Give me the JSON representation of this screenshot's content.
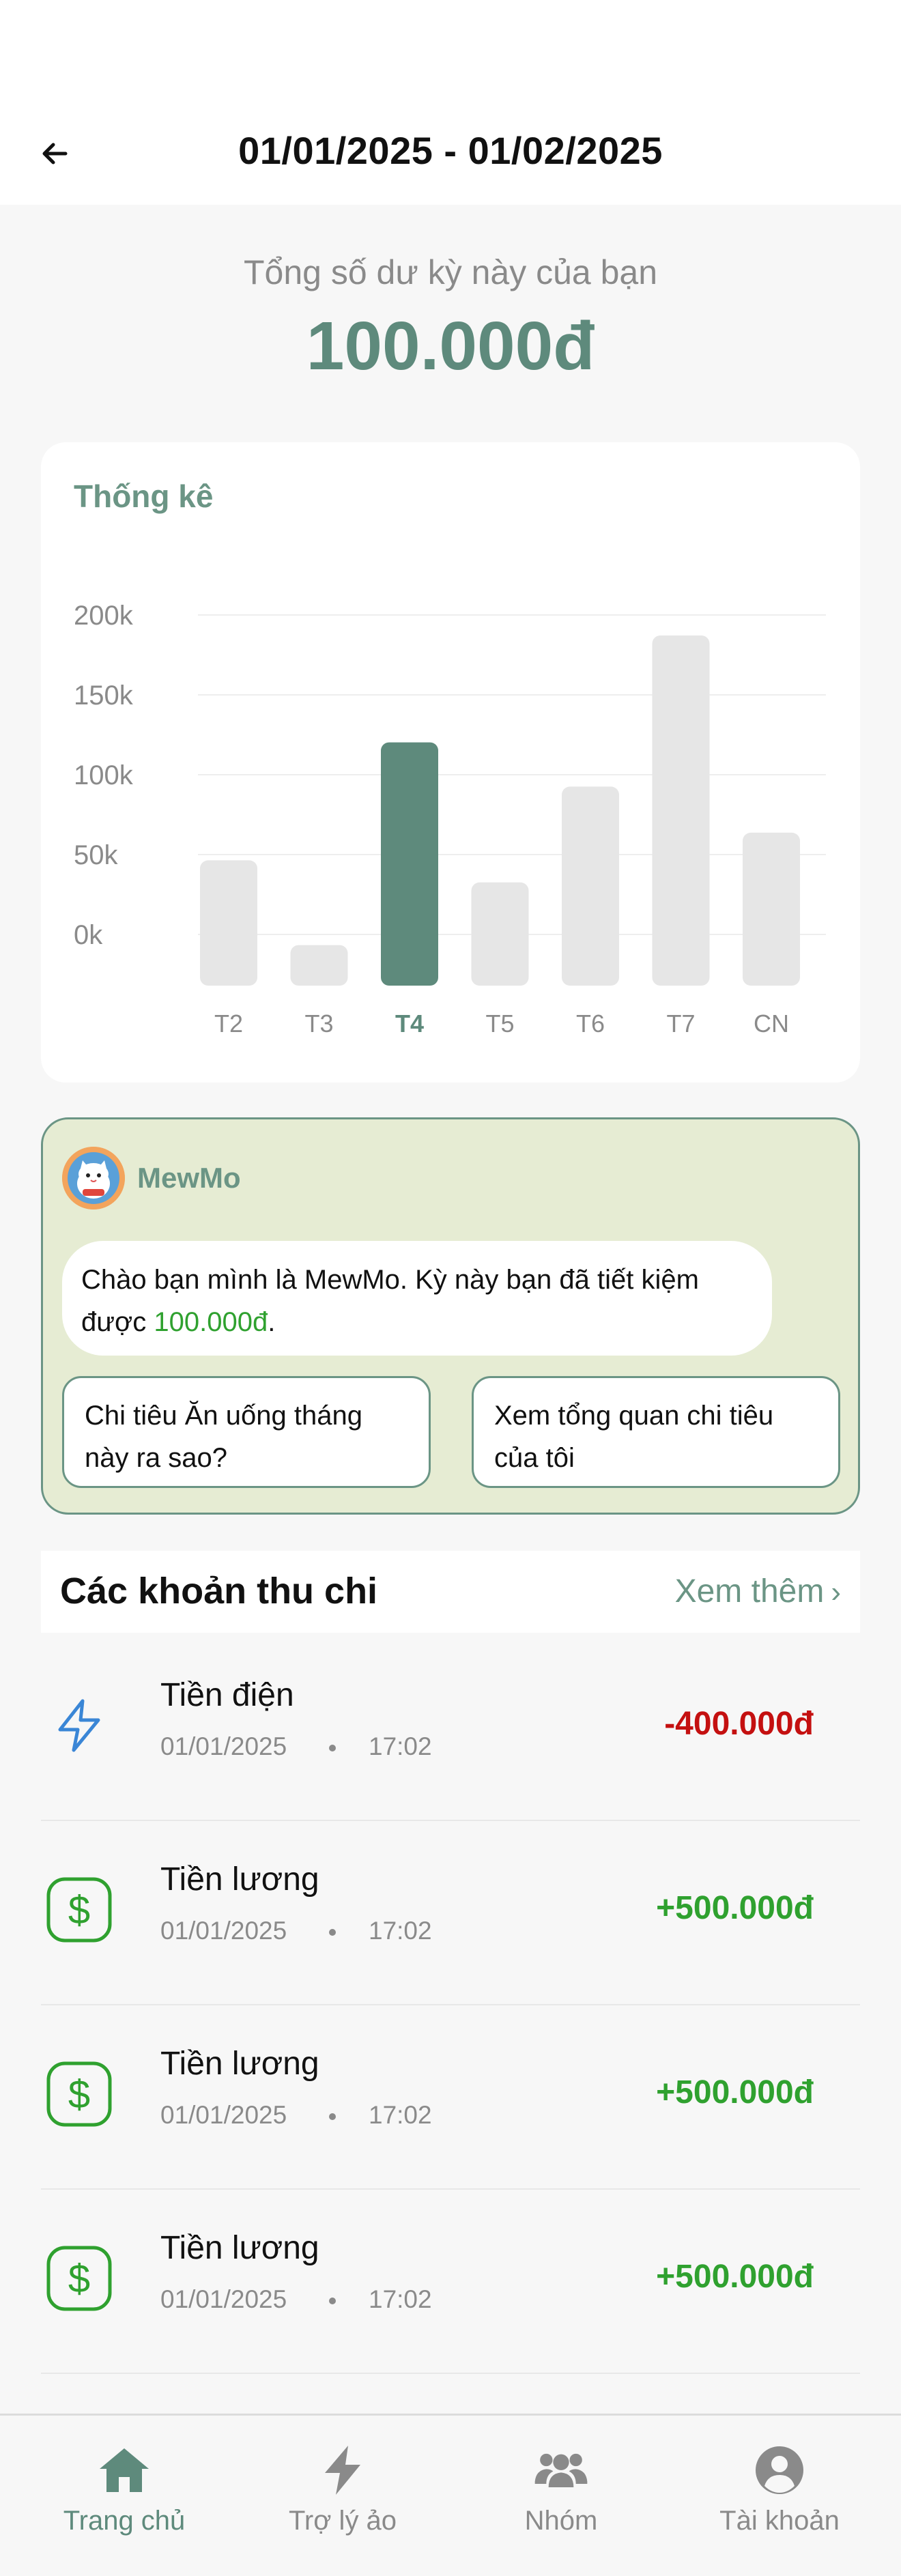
{
  "header": {
    "title": "01/01/2025 - 01/02/2025",
    "back_icon": "arrow-left-icon"
  },
  "balance": {
    "label": "Tổng số dư kỳ này của bạn",
    "value": "100.000đ"
  },
  "stats": {
    "title": "Thống kê"
  },
  "chart_data": {
    "type": "bar",
    "categories": [
      "T2",
      "T3",
      "T4",
      "T5",
      "T6",
      "T7",
      "CN"
    ],
    "values": [
      68,
      22,
      132,
      56,
      108,
      190,
      83
    ],
    "highlighted_category": "T4",
    "ytick_labels": [
      "200k",
      "150k",
      "100k",
      "50k",
      "0k"
    ],
    "colors": {
      "bar": "#e6e6e6",
      "highlight": "#5e8a7c",
      "grid": "#eeeeee"
    }
  },
  "assistant": {
    "name": "MewMo",
    "message_prefix": "Chào bạn mình là MewMo. Kỳ này bạn đã tiết kiệm được ",
    "message_amount": "100.000đ",
    "message_suffix": ".",
    "suggestions": [
      "Chi tiêu Ăn uống tháng này ra sao?",
      "Xem tổng quan chi tiêu của tôi"
    ]
  },
  "transactions_section": {
    "title": "Các khoản thu chi",
    "see_more": "Xem thêm",
    "see_more_icon": "chevron-right-icon"
  },
  "transactions": [
    {
      "name": "Tiền điện",
      "date": "01/01/2025",
      "time": "17:02",
      "amount": "-400.000đ",
      "type": "expense",
      "icon": "lightning-icon"
    },
    {
      "name": "Tiền lương",
      "date": "01/01/2025",
      "time": "17:02",
      "amount": "+500.000đ",
      "type": "income",
      "icon": "dollar-icon"
    },
    {
      "name": "Tiền lương",
      "date": "01/01/2025",
      "time": "17:02",
      "amount": "+500.000đ",
      "type": "income",
      "icon": "dollar-icon"
    },
    {
      "name": "Tiền lương",
      "date": "01/01/2025",
      "time": "17:02",
      "amount": "+500.000đ",
      "type": "income",
      "icon": "dollar-icon"
    }
  ],
  "nav": [
    {
      "label": "Trang chủ",
      "icon": "home-icon",
      "active": true
    },
    {
      "label": "Trợ lý ảo",
      "icon": "lightning-icon",
      "active": false
    },
    {
      "label": "Nhóm",
      "icon": "group-icon",
      "active": false
    },
    {
      "label": "Tài khoản",
      "icon": "account-icon",
      "active": false
    }
  ],
  "colors": {
    "accent": "#5e8a7c",
    "income": "#2fa12f",
    "expense": "#c41010",
    "assistant_bg": "#e6ecd3"
  }
}
